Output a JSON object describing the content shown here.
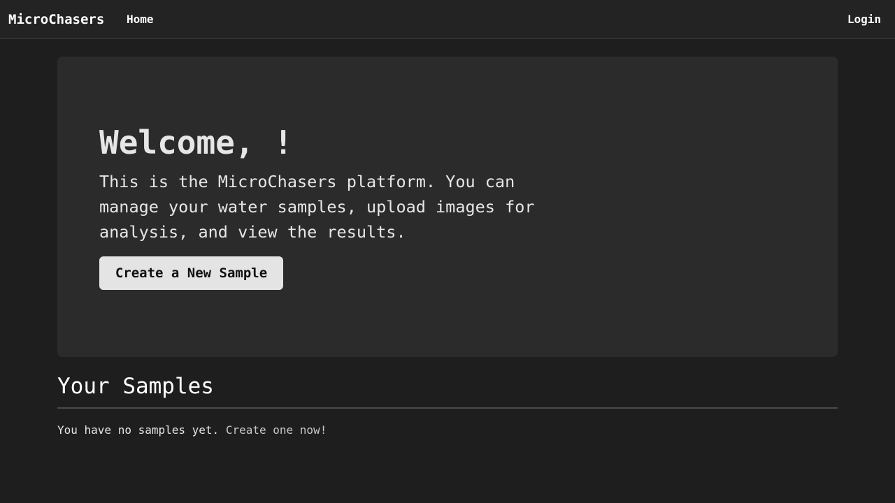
{
  "navbar": {
    "brand": "MicroChasers",
    "home_label": "Home",
    "login_label": "Login"
  },
  "hero": {
    "title": "Welcome, !",
    "text": "This is the MicroChasers platform. You can manage your water samples, upload images for analysis, and view the results.",
    "button_label": "Create a New Sample"
  },
  "samples": {
    "heading": "Your Samples",
    "empty_text": "You have no samples yet.",
    "create_link_label": "Create one now!"
  },
  "colors": {
    "page_background": "#1e1e1e",
    "navbar_background": "#232323",
    "hero_background": "#2b2b2b",
    "button_background": "#e4e4e4"
  }
}
